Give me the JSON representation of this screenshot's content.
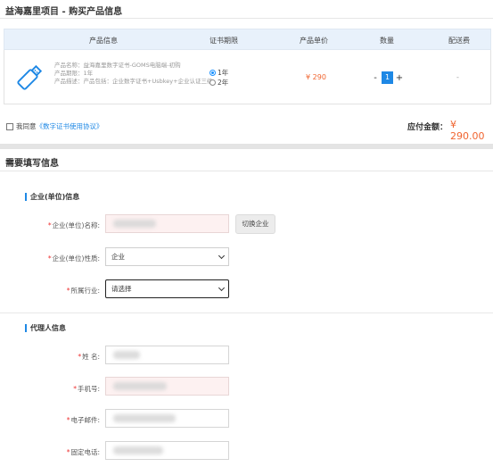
{
  "page": {
    "title": "益海嘉里项目 - 购买产品信息"
  },
  "table": {
    "headers": [
      "产品信息",
      "证书期限",
      "产品单价",
      "数量",
      "配送费"
    ],
    "product": {
      "name_line": "产品名称：益海嘉里数字证书-GOMS电脑端-初购",
      "period_line": "产品期限：1年",
      "desc_line": "产品描述：产品包括：企业数字证书+Usbkey+企业认证三级"
    },
    "period_options": [
      "1年",
      "2年"
    ],
    "price": "¥ 290",
    "quantity": "1",
    "minus_label": "-",
    "plus_label": "+",
    "delivery_fee": "-"
  },
  "agreement": {
    "prefix": "我同意",
    "link": "《数字证书使用协议》"
  },
  "total": {
    "label": "应付金额：",
    "value": "¥ 290.00"
  },
  "form": {
    "section_title": "需要填写信息",
    "company": {
      "title": "企业(单位)信息",
      "name_label": "企业(单位)名称:",
      "switch_button": "切换企业",
      "type_label": "企业(单位)性质:",
      "type_value": "企业",
      "industry_label": "所属行业:",
      "industry_value": "请选择"
    },
    "agent": {
      "title": "代理人信息",
      "name_label": "姓 名:",
      "phone_label": "手机号:",
      "email_label": "电子邮件:",
      "landline_label": "固定电话:"
    },
    "required_mark": "*"
  },
  "colors": {
    "accent": "#1e88e5",
    "price": "#f0642f",
    "required": "#ee3333",
    "header_bg": "#e8f1fb"
  }
}
